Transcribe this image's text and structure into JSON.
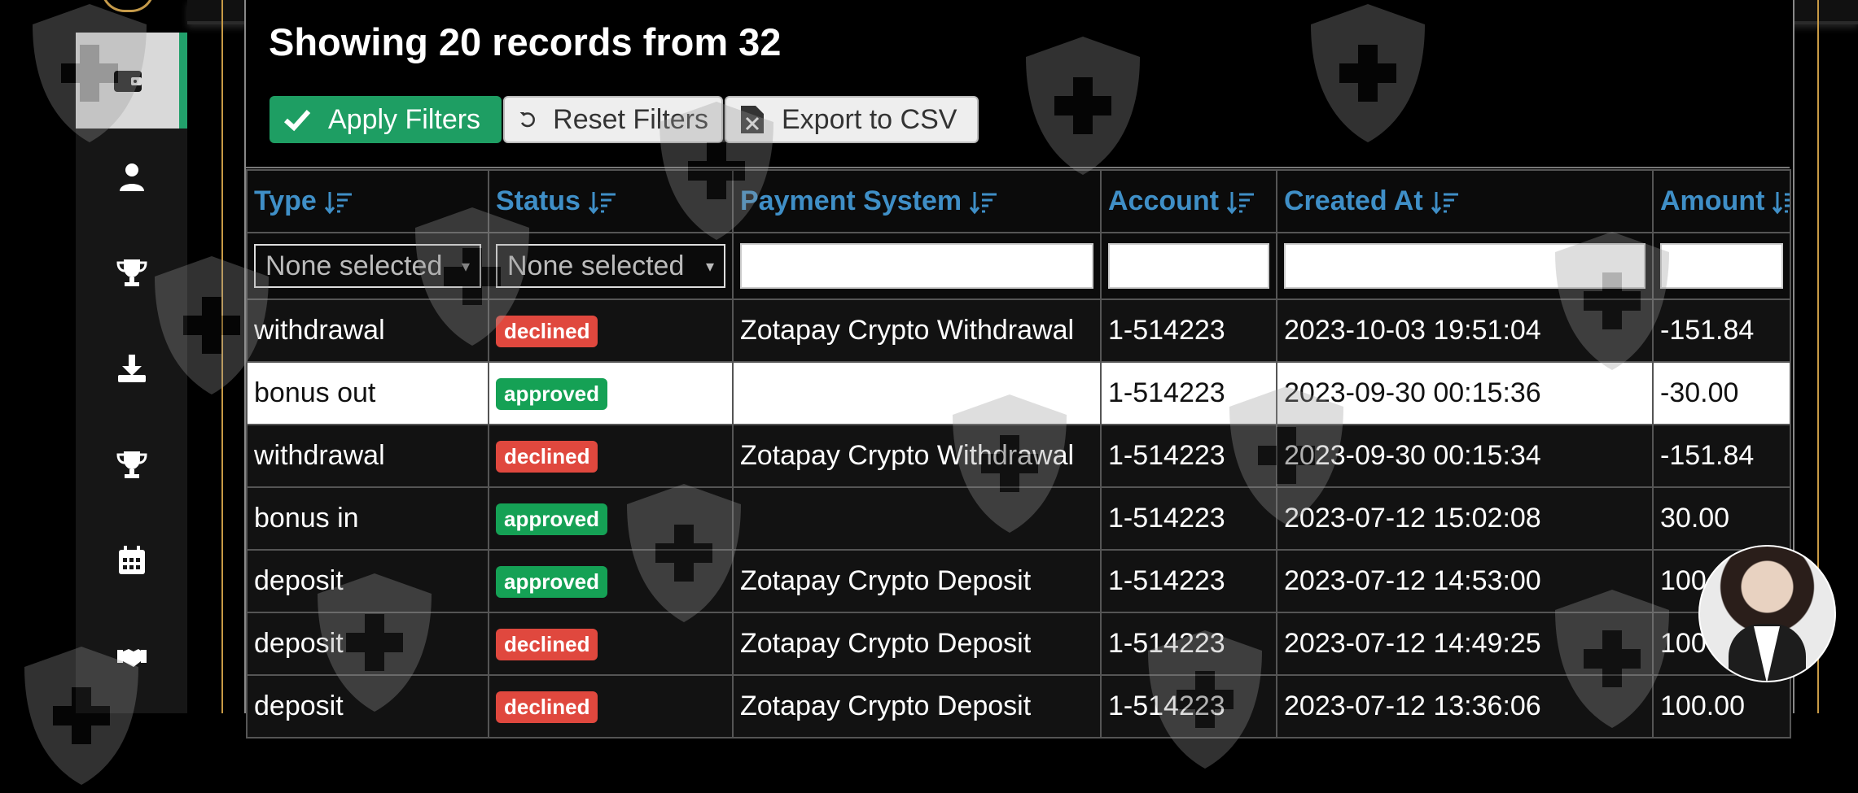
{
  "heading": "Showing 20 records from 32",
  "buttons": {
    "apply": "Apply Filters",
    "reset": "Reset Filters",
    "export": "Export to CSV"
  },
  "columns": [
    "Type",
    "Status",
    "Payment System",
    "Account",
    "Created At",
    "Amount"
  ],
  "filters": {
    "type_placeholder": "None selected",
    "status_placeholder": "None selected"
  },
  "rows": [
    {
      "type": "withdrawal",
      "status": "declined",
      "payment_system": "Zotapay Crypto Withdrawal",
      "account": "1-514223",
      "created_at": "2023-10-03 19:51:04",
      "amount": "-151.84"
    },
    {
      "type": "bonus out",
      "status": "approved",
      "payment_system": "",
      "account": "1-514223",
      "created_at": "2023-09-30 00:15:36",
      "amount": "-30.00"
    },
    {
      "type": "withdrawal",
      "status": "declined",
      "payment_system": "Zotapay Crypto Withdrawal",
      "account": "1-514223",
      "created_at": "2023-09-30 00:15:34",
      "amount": "-151.84"
    },
    {
      "type": "bonus in",
      "status": "approved",
      "payment_system": "",
      "account": "1-514223",
      "created_at": "2023-07-12 15:02:08",
      "amount": "30.00"
    },
    {
      "type": "deposit",
      "status": "approved",
      "payment_system": "Zotapay Crypto Deposit",
      "account": "1-514223",
      "created_at": "2023-07-12 14:53:00",
      "amount": "100"
    },
    {
      "type": "deposit",
      "status": "declined",
      "payment_system": "Zotapay Crypto Deposit",
      "account": "1-514223",
      "created_at": "2023-07-12 14:49:25",
      "amount": "100"
    },
    {
      "type": "deposit",
      "status": "declined",
      "payment_system": "Zotapay Crypto Deposit",
      "account": "1-514223",
      "created_at": "2023-07-12 13:36:06",
      "amount": "100.00"
    }
  ],
  "sidebar": {
    "items": [
      "wallet-icon",
      "user-icon",
      "trophy-icon",
      "download-icon",
      "trophy-icon",
      "calendar-icon",
      "handshake-icon"
    ]
  },
  "colors": {
    "accent_link": "#3f8fc7",
    "apply_green": "#1e9e63",
    "declined": "#e0483e",
    "approved": "#15a155",
    "frame_gold": "#c89a45"
  }
}
